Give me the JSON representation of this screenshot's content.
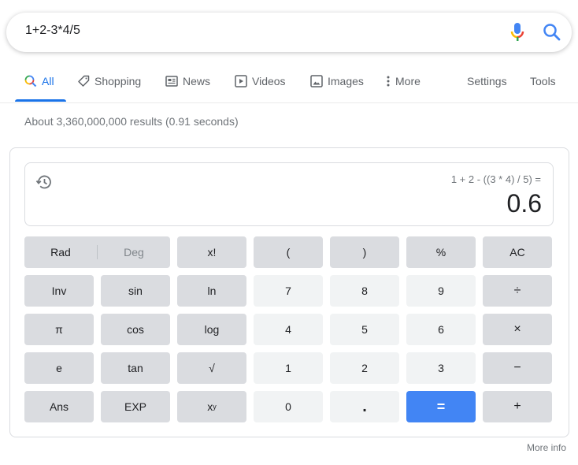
{
  "search": {
    "query": "1+2-3*4/5",
    "mic_icon": "microphone-icon",
    "search_icon": "search-icon"
  },
  "tabs": [
    {
      "label": "All",
      "icon": "search-icon",
      "active": true
    },
    {
      "label": "Shopping",
      "icon": "tag-icon",
      "active": false
    },
    {
      "label": "News",
      "icon": "newspaper-icon",
      "active": false
    },
    {
      "label": "Videos",
      "icon": "play-icon",
      "active": false
    },
    {
      "label": "Images",
      "icon": "image-icon",
      "active": false
    },
    {
      "label": "More",
      "icon": "more-vertical-icon",
      "active": false
    }
  ],
  "tools": {
    "settings_label": "Settings",
    "tools_label": "Tools"
  },
  "results_stats": "About 3,360,000,000 results (0.91 seconds)",
  "calculator": {
    "expression": "1 + 2 - ((3 * 4) / 5) =",
    "result": "0.6",
    "history_icon": "history-icon",
    "angle_mode": {
      "rad": "Rad",
      "deg": "Deg",
      "selected": "Rad"
    },
    "buttons": {
      "fact": "x!",
      "lparen": "(",
      "rparen": ")",
      "percent": "%",
      "clear": "AC",
      "inv": "Inv",
      "sin": "sin",
      "ln": "ln",
      "d7": "7",
      "d8": "8",
      "d9": "9",
      "divide": "÷",
      "pi": "π",
      "cos": "cos",
      "log": "log",
      "d4": "4",
      "d5": "5",
      "d6": "6",
      "multiply": "×",
      "e": "e",
      "tan": "tan",
      "sqrt": "√",
      "d1": "1",
      "d2": "2",
      "d3": "3",
      "minus": "−",
      "ans": "Ans",
      "exp": "EXP",
      "pow_base": "x",
      "pow_exp": "y",
      "d0": "0",
      "dot": ".",
      "equals": "=",
      "plus": "+"
    },
    "equals_color": "#4285f4"
  },
  "more_info": "More info",
  "colors": {
    "accent": "#1a73e8",
    "secondary_text": "#70757a"
  }
}
